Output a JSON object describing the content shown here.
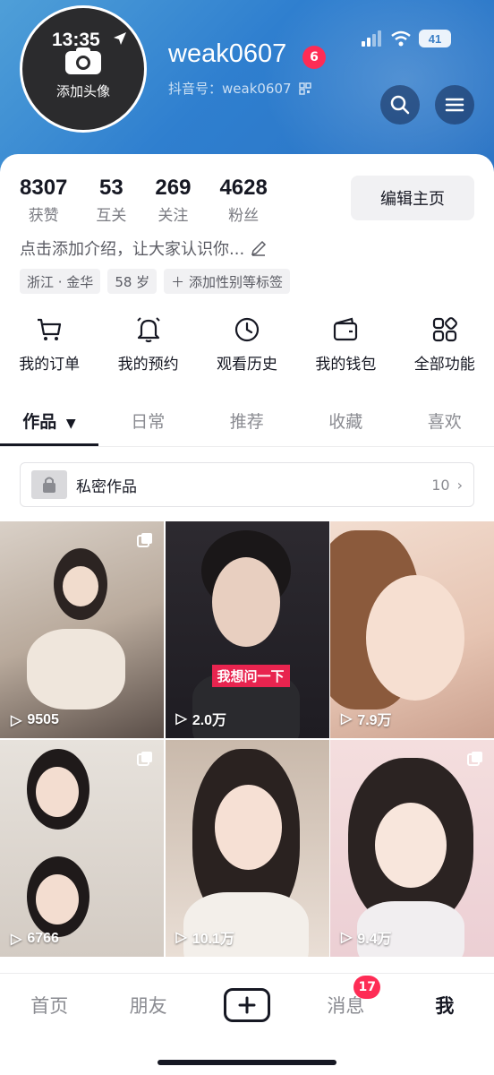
{
  "status_bar": {
    "time": "13:35",
    "battery": "41"
  },
  "profile": {
    "avatar_label": "添加头像",
    "username": "weak0607",
    "notification_count": "6",
    "douyin_id": "抖音号：weak0607"
  },
  "stats": [
    {
      "value": "8307",
      "label": "获赞"
    },
    {
      "value": "53",
      "label": "互关"
    },
    {
      "value": "269",
      "label": "关注"
    },
    {
      "value": "4628",
      "label": "粉丝"
    }
  ],
  "edit_button": "编辑主页",
  "bio": "点击添加介绍，让大家认识你...",
  "tags": [
    "浙江 · 金华",
    "58 岁",
    "＋ 添加性别等标签"
  ],
  "quick_actions": [
    {
      "label": "我的订单",
      "icon": "cart-icon"
    },
    {
      "label": "我的预约",
      "icon": "bell-icon"
    },
    {
      "label": "观看历史",
      "icon": "clock-icon"
    },
    {
      "label": "我的钱包",
      "icon": "wallet-icon"
    },
    {
      "label": "全部功能",
      "icon": "grid-icon"
    }
  ],
  "tabs": [
    {
      "label": "作品",
      "active": true
    },
    {
      "label": "日常"
    },
    {
      "label": "推荐"
    },
    {
      "label": "收藏"
    },
    {
      "label": "喜欢"
    }
  ],
  "private_works": {
    "label": "私密作品",
    "count": "10"
  },
  "videos": [
    {
      "views": "9505",
      "multi": true
    },
    {
      "views": "2.0万",
      "overlay": "我想问一下"
    },
    {
      "views": "7.9万"
    },
    {
      "views": "6766",
      "multi": true
    },
    {
      "views": "10.1万"
    },
    {
      "views": "9.4万",
      "multi": true
    }
  ],
  "bottom_nav": {
    "home": "首页",
    "friends": "朋友",
    "messages": "消息",
    "messages_badge": "17",
    "me": "我"
  }
}
